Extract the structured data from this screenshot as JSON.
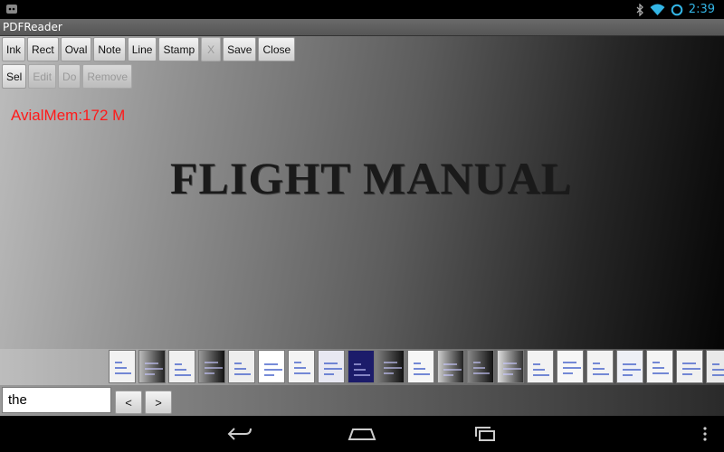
{
  "status_bar": {
    "time": "2:39",
    "icons": [
      "app-logo-icon",
      "bluetooth-icon",
      "wifi-icon",
      "sync-ring-icon"
    ]
  },
  "app": {
    "title": "PDFReader"
  },
  "toolbar": {
    "row1": [
      {
        "key": "ink",
        "label": "Ink",
        "enabled": true
      },
      {
        "key": "rect",
        "label": "Rect",
        "enabled": true
      },
      {
        "key": "oval",
        "label": "Oval",
        "enabled": true
      },
      {
        "key": "note",
        "label": "Note",
        "enabled": true
      },
      {
        "key": "line",
        "label": "Line",
        "enabled": true
      },
      {
        "key": "stamp",
        "label": "Stamp",
        "enabled": true
      },
      {
        "key": "x",
        "label": "X",
        "enabled": false
      },
      {
        "key": "save",
        "label": "Save",
        "enabled": true
      },
      {
        "key": "close",
        "label": "Close",
        "enabled": true
      }
    ],
    "row2": [
      {
        "key": "sel",
        "label": "Sel",
        "enabled": true
      },
      {
        "key": "edit",
        "label": "Edit",
        "enabled": false
      },
      {
        "key": "do",
        "label": "Do",
        "enabled": false
      },
      {
        "key": "remove",
        "label": "Remove",
        "enabled": false
      }
    ]
  },
  "memory_label": "AvialMem:172 M",
  "page_heading": "FLIGHT MANUAL",
  "search": {
    "value": "the",
    "prev_label": "<",
    "next_label": ">"
  },
  "colors": {
    "memory_text": "#ff1a1a",
    "status_accent": "#33b5e5"
  },
  "navbar": {
    "icons": [
      "back-icon",
      "home-icon",
      "recent-apps-icon",
      "overflow-menu-icon"
    ]
  }
}
